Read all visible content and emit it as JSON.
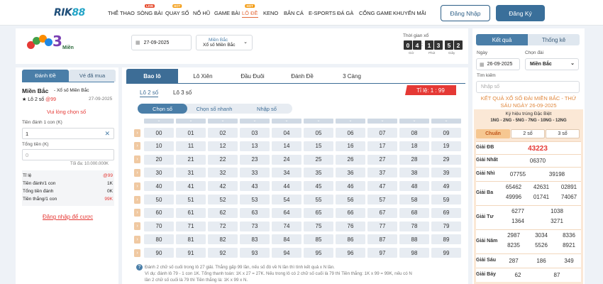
{
  "brand": {
    "logo_prefix": "RIK",
    "logo_suffix": "88"
  },
  "nav": [
    {
      "label": "THỂ THAO",
      "badge": ""
    },
    {
      "label": "SÒNG BÀI",
      "badge": "LIVE"
    },
    {
      "label": "QUAY SỐ",
      "badge": "HOT"
    },
    {
      "label": "NỔ HŨ",
      "badge": ""
    },
    {
      "label": "GAME BÀI",
      "badge": ""
    },
    {
      "label": "LÔ ĐỀ",
      "badge": "HOT"
    },
    {
      "label": "KENO",
      "badge": ""
    },
    {
      "label": "BẮN CÁ",
      "badge": ""
    },
    {
      "label": "E-SPORTS",
      "badge": ""
    },
    {
      "label": "ĐÁ GÀ",
      "badge": ""
    },
    {
      "label": "CỔNG GAME",
      "badge": ""
    },
    {
      "label": "KHUYẾN MÃI",
      "badge": ""
    }
  ],
  "auth": {
    "login": "Đăng Nhập",
    "register": "Đăng Ký"
  },
  "game": {
    "logo_text": "Miền",
    "date": "27-09-2025",
    "region_top": "Miền Bắc",
    "region_bottom": "Xổ số Miền Bắc"
  },
  "timer": {
    "label": "Thời gian xổ",
    "digits": [
      "0",
      "4",
      "1",
      "3",
      "5",
      "2"
    ],
    "units": [
      "Giờ",
      "Phút",
      "Giây"
    ]
  },
  "left": {
    "tab_bet": "Đánh Đề",
    "tab_bought": "Vé đã mua",
    "region": "Miền Bắc",
    "region_sub": "- Xổ số Miền Bắc",
    "bet_name": "★ Lô 2 số",
    "bet_odds": "@99",
    "bet_date": "27-09-2025",
    "choose_prompt": "Vui lòng chọn số",
    "amount_label": "Tiền đánh 1 con (K)",
    "amount_value": "1",
    "total_label": "Tổng tiền (K)",
    "total_value": "0",
    "max_note": "Tối đa: 10.000.000K",
    "summary": [
      {
        "label": "Tỉ lệ",
        "value": "@99"
      },
      {
        "label": "Tiền đánh/1 con",
        "value": "1K"
      },
      {
        "label": "Tổng tiền đánh",
        "value": "0K"
      },
      {
        "label": "Tiền thắng/1 con",
        "value": "99K"
      }
    ],
    "login_link": "Đăng nhập để cược"
  },
  "main": {
    "tabs": [
      "Bao lô",
      "Lô Xiên",
      "Đầu Đuôi",
      "Đánh Đề",
      "3 Càng"
    ],
    "sub_tabs": [
      "Lô 2 số",
      "Lô 3 số"
    ],
    "rate": "Tỉ lệ: 1 : 99",
    "modes": [
      "Chọn số",
      "Chọn số nhanh",
      "Nhập số"
    ],
    "numbers": [
      [
        "00",
        "01",
        "02",
        "03",
        "04",
        "05",
        "06",
        "07",
        "08",
        "09"
      ],
      [
        "10",
        "11",
        "12",
        "13",
        "14",
        "15",
        "16",
        "17",
        "18",
        "19"
      ],
      [
        "20",
        "21",
        "22",
        "23",
        "24",
        "25",
        "26",
        "27",
        "28",
        "29"
      ],
      [
        "30",
        "31",
        "32",
        "33",
        "34",
        "35",
        "36",
        "37",
        "38",
        "39"
      ],
      [
        "40",
        "41",
        "42",
        "43",
        "44",
        "45",
        "46",
        "47",
        "48",
        "49"
      ],
      [
        "50",
        "51",
        "52",
        "53",
        "54",
        "55",
        "56",
        "57",
        "58",
        "59"
      ],
      [
        "60",
        "61",
        "62",
        "63",
        "64",
        "65",
        "66",
        "67",
        "68",
        "69"
      ],
      [
        "70",
        "71",
        "72",
        "73",
        "74",
        "75",
        "76",
        "77",
        "78",
        "79"
      ],
      [
        "80",
        "81",
        "82",
        "83",
        "84",
        "85",
        "86",
        "87",
        "88",
        "89"
      ],
      [
        "90",
        "91",
        "92",
        "93",
        "94",
        "95",
        "96",
        "97",
        "98",
        "99"
      ]
    ],
    "notes": [
      "Đánh 2 chữ số cuối trong lô 27 giải. Thắng gấp 99 lần, nếu số đó về N lần thì tính kết quả x N lần.",
      "Ví dụ: đánh lô 79 - 1 con 1K. Tổng thanh toán: 1K x 27 = 27K. Nếu trong lô có 2 chữ số cuối là 79 thì Tiền thắng: 1K x 99 = 99K, nếu có N",
      "lần 2 chữ số cuối là 79 thì Tiền thắng là: 1K x 99 x N."
    ]
  },
  "right": {
    "tabs": [
      "Kết quả",
      "Thống kê"
    ],
    "day_label": "Ngày",
    "day_value": "26-09-2025",
    "region_label": "Chọn đài",
    "region_value": "Miền Bắc",
    "search_label": "Tìm kiếm",
    "search_placeholder": "Nhập số",
    "result_title_1": "KẾT QUẢ XỔ SỐ ĐÀI MIỀN BẮC - THỨ",
    "result_title_2": "SÁU NGÀY 26-09-2025",
    "special_label": "Ký hiệu trúng Đặc Biệt",
    "special_codes": "1NG - 2NG - 5NG - 7NG - 10NG - 12NG",
    "filters": [
      "Chuẩn",
      "2 số",
      "3 số"
    ],
    "prizes": [
      {
        "label": "Giải ĐB",
        "values": [
          "43223"
        ]
      },
      {
        "label": "Giải Nhất",
        "values": [
          "06370"
        ]
      },
      {
        "label": "Giải Nhì",
        "values": [
          "07755",
          "39198"
        ]
      },
      {
        "label": "Giải Ba",
        "values": [
          "65462",
          "42631",
          "02891",
          "49996",
          "01741",
          "74067"
        ]
      },
      {
        "label": "Giải Tư",
        "values": [
          "6277",
          "1038",
          "1364",
          "3271"
        ]
      },
      {
        "label": "Giải Năm",
        "values": [
          "2987",
          "3034",
          "8336",
          "8235",
          "5526",
          "8921"
        ]
      },
      {
        "label": "Giải Sáu",
        "values": [
          "287",
          "186",
          "349"
        ]
      },
      {
        "label": "Giải Bảy",
        "values": [
          "62",
          "87"
        ]
      }
    ]
  },
  "colors": {
    "accent": "#e46a3a",
    "primary": "#3d6d96",
    "red": "#e53935"
  }
}
